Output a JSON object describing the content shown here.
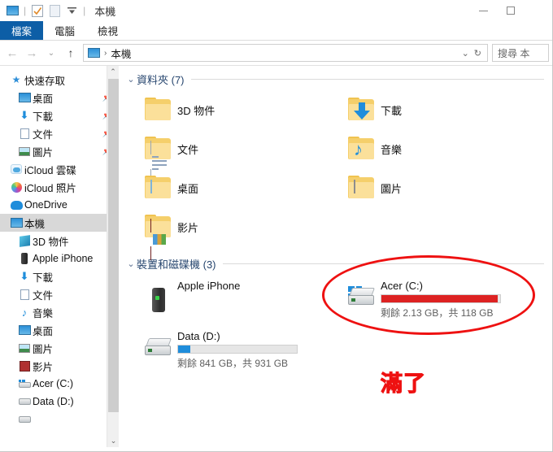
{
  "window": {
    "title": "本機",
    "quick_access_icons": [
      "monitor-icon",
      "properties-icon",
      "new-folder-icon",
      "customize-chevron-icon"
    ],
    "controls": {
      "minimize": "—",
      "maximize": "▢",
      "close": "✕"
    }
  },
  "ribbon": {
    "tabs": [
      {
        "label": "檔案",
        "active": true
      },
      {
        "label": "電腦",
        "active": false
      },
      {
        "label": "檢視",
        "active": false
      }
    ]
  },
  "address_bar": {
    "back": "←",
    "forward": "→",
    "history": "⌄",
    "up": "↑",
    "breadcrumb_icon": "monitor-icon",
    "breadcrumb_sep": "›",
    "breadcrumb": "本機",
    "dropdown": "⌄",
    "refresh": "↻",
    "search_placeholder": "搜尋 本"
  },
  "sidebar": {
    "items": [
      {
        "label": "快速存取",
        "icon": "star-icon",
        "level": 0,
        "pinned": false,
        "selected": false
      },
      {
        "label": "桌面",
        "icon": "desktop-icon",
        "level": 1,
        "pinned": true,
        "selected": false
      },
      {
        "label": "下載",
        "icon": "download-icon",
        "level": 1,
        "pinned": true,
        "selected": false
      },
      {
        "label": "文件",
        "icon": "documents-icon",
        "level": 1,
        "pinned": true,
        "selected": false
      },
      {
        "label": "圖片",
        "icon": "pictures-icon",
        "level": 1,
        "pinned": true,
        "selected": false
      },
      {
        "label": "iCloud 雲碟",
        "icon": "icloud-drive-icon",
        "level": 0,
        "pinned": false,
        "selected": false
      },
      {
        "label": "iCloud 照片",
        "icon": "icloud-photos-icon",
        "level": 0,
        "pinned": false,
        "selected": false
      },
      {
        "label": "OneDrive",
        "icon": "onedrive-icon",
        "level": 0,
        "pinned": false,
        "selected": false
      },
      {
        "label": "本機",
        "icon": "this-pc-icon",
        "level": 0,
        "pinned": false,
        "selected": true
      },
      {
        "label": "3D 物件",
        "icon": "3d-objects-icon",
        "level": 1,
        "pinned": false,
        "selected": false
      },
      {
        "label": "Apple iPhone",
        "icon": "phone-icon",
        "level": 1,
        "pinned": false,
        "selected": false
      },
      {
        "label": "下載",
        "icon": "download-icon",
        "level": 1,
        "pinned": false,
        "selected": false
      },
      {
        "label": "文件",
        "icon": "documents-icon",
        "level": 1,
        "pinned": false,
        "selected": false
      },
      {
        "label": "音樂",
        "icon": "music-icon",
        "level": 1,
        "pinned": false,
        "selected": false
      },
      {
        "label": "桌面",
        "icon": "desktop-icon",
        "level": 1,
        "pinned": false,
        "selected": false
      },
      {
        "label": "圖片",
        "icon": "pictures-icon",
        "level": 1,
        "pinned": false,
        "selected": false
      },
      {
        "label": "影片",
        "icon": "videos-icon",
        "level": 1,
        "pinned": false,
        "selected": false
      },
      {
        "label": "Acer (C:)",
        "icon": "windows-drive-icon",
        "level": 1,
        "pinned": false,
        "selected": false
      },
      {
        "label": "Data (D:)",
        "icon": "drive-icon",
        "level": 1,
        "pinned": false,
        "selected": false
      }
    ],
    "scroll_up": "⌃",
    "scroll_down": "⌄"
  },
  "main": {
    "groups": [
      {
        "chevron": "⌄",
        "label": "資料夾 (7)"
      },
      {
        "chevron": "⌄",
        "label": "裝置和磁碟機 (3)"
      }
    ],
    "folders": [
      {
        "label": "3D 物件",
        "icon": "folder-3d-objects-icon"
      },
      {
        "label": "下載",
        "icon": "folder-downloads-icon"
      },
      {
        "label": "文件",
        "icon": "folder-documents-icon"
      },
      {
        "label": "音樂",
        "icon": "folder-music-icon"
      },
      {
        "label": "桌面",
        "icon": "folder-desktop-icon"
      },
      {
        "label": "圖片",
        "icon": "folder-pictures-icon"
      },
      {
        "label": "影片",
        "icon": "folder-videos-icon"
      }
    ],
    "drives": [
      {
        "name": "Apple iPhone",
        "icon": "phone-device-icon",
        "has_bar": false,
        "capacity_text": ""
      },
      {
        "name": "Acer (C:)",
        "icon": "windows-drive-icon",
        "has_bar": true,
        "bar_color": "#dd2222",
        "bar_fill_percent": 98,
        "capacity_text": "剩餘 2.13 GB，共 118 GB",
        "free": "2.13 GB",
        "total": "118 GB"
      },
      {
        "name": "Data (D:)",
        "icon": "drive-icon",
        "has_bar": true,
        "bar_color": "#1f8ddb",
        "bar_fill_percent": 10,
        "capacity_text": "剩餘 841 GB，共 931 GB",
        "free": "841 GB",
        "total": "931 GB"
      }
    ]
  },
  "annotation": {
    "text": "滿了",
    "color": "#ee1111",
    "shape": "ellipse-highlight"
  }
}
